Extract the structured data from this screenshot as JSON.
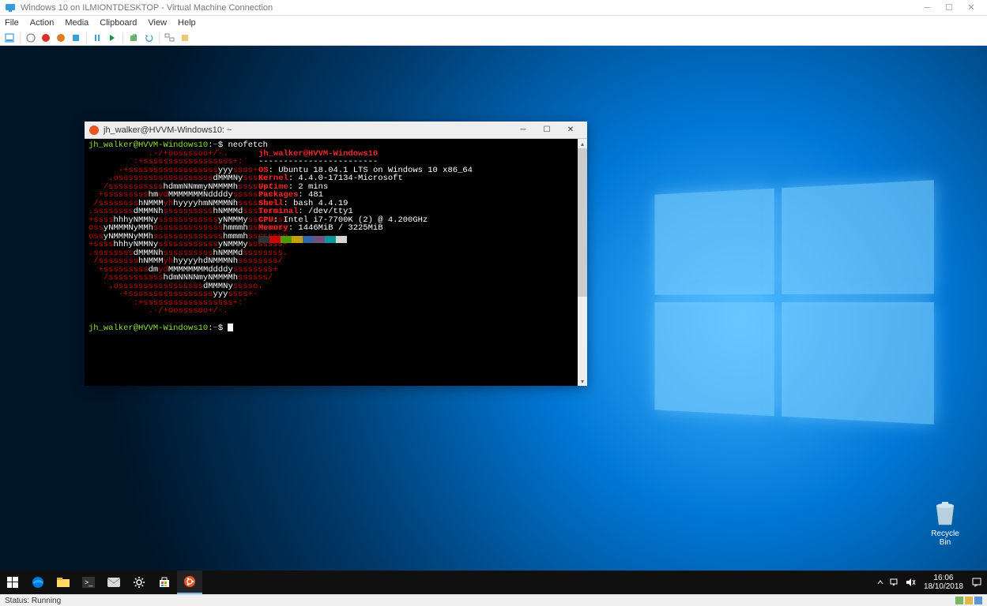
{
  "outer_window": {
    "title": "Windows 10 on ILMIONTDESKTOP - Virtual Machine Connection"
  },
  "menubar": [
    "File",
    "Action",
    "Media",
    "Clipboard",
    "View",
    "Help"
  ],
  "guest": {
    "recycle_bin_label": "Recycle Bin",
    "clock_time": "16:06",
    "clock_date": "18/10/2018"
  },
  "terminal": {
    "title": "jh_walker@HVVM-Windows10: ~",
    "prompt_user": "jh_walker@HVVM-Windows10",
    "prompt_sep": ":",
    "prompt_path": "~",
    "prompt_sym": "$",
    "command": "neofetch",
    "neofetch": {
      "header": "jh_walker@HVVM-Windows10",
      "dashes": "------------------------",
      "info": [
        {
          "label": "OS",
          "value": "Ubuntu 18.04.1 LTS on Windows 10 x86_64"
        },
        {
          "label": "Kernel",
          "value": "4.4.0-17134-Microsoft"
        },
        {
          "label": "Uptime",
          "value": "2 mins"
        },
        {
          "label": "Packages",
          "value": "481"
        },
        {
          "label": "Shell",
          "value": "bash 4.4.19"
        },
        {
          "label": "Terminal",
          "value": "/dev/tty1"
        },
        {
          "label": "CPU",
          "value": "Intel i7-7700K (2) @ 4.200GHz"
        },
        {
          "label": "Memory",
          "value": "1446MiB / 3225MiB"
        }
      ],
      "colors": [
        "#2e3436",
        "#cc0000",
        "#4e9a06",
        "#c4a000",
        "#3465a4",
        "#75507b",
        "#06989a",
        "#d3d7cf"
      ]
    }
  },
  "statusbar": {
    "text": "Status: Running"
  }
}
